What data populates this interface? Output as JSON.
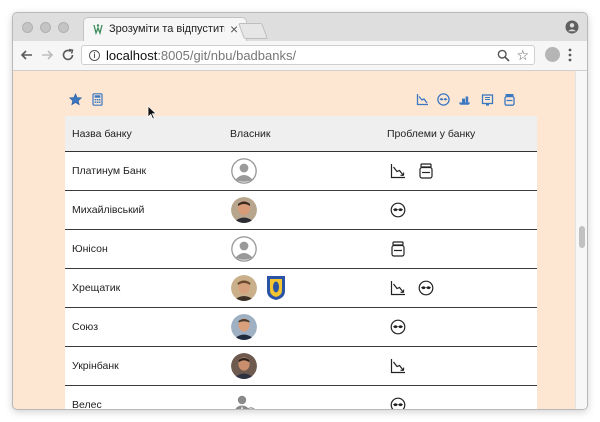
{
  "browser": {
    "tab_title": "Зрозуміти та відпустити: при",
    "tab_close": "×",
    "url_host": "localhost",
    "url_path": ":8005/git/nbu/badbanks/",
    "info_icon": "i",
    "star_glyph": "☆"
  },
  "toolbar_icons": {
    "left": [
      "star-icon",
      "calculator-icon"
    ],
    "right": [
      "declining-chart-icon",
      "sanctions-icon",
      "shipping-icon",
      "flag-icon",
      "jar-icon"
    ]
  },
  "table": {
    "headers": {
      "bank": "Назва банку",
      "owner": "Власник",
      "problems": "Проблеми у банку"
    },
    "rows": [
      {
        "bank": "Платинум Банк",
        "owners": [
          "placeholder"
        ],
        "problems": [
          "declining-chart-icon",
          "jar-icon"
        ]
      },
      {
        "bank": "Михайлівський",
        "owners": [
          "photo-a"
        ],
        "problems": [
          "sanctions-icon"
        ]
      },
      {
        "bank": "Юнісон",
        "owners": [
          "placeholder"
        ],
        "problems": [
          "jar-icon"
        ]
      },
      {
        "bank": "Хрещатик",
        "owners": [
          "photo-b",
          "kyiv-emblem"
        ],
        "problems": [
          "declining-chart-icon",
          "sanctions-icon"
        ]
      },
      {
        "bank": "Союз",
        "owners": [
          "photo-c"
        ],
        "problems": [
          "sanctions-icon"
        ]
      },
      {
        "bank": "Укрінбанк",
        "owners": [
          "photo-d"
        ],
        "problems": [
          "declining-chart-icon"
        ]
      },
      {
        "bank": "Велес",
        "owners": [
          "group-placeholder"
        ],
        "problems": [
          "sanctions-icon"
        ]
      }
    ]
  },
  "colors": {
    "page_background": "#fde6d2",
    "table_header": "#efefef",
    "accent_blue": "#3b78c2"
  }
}
